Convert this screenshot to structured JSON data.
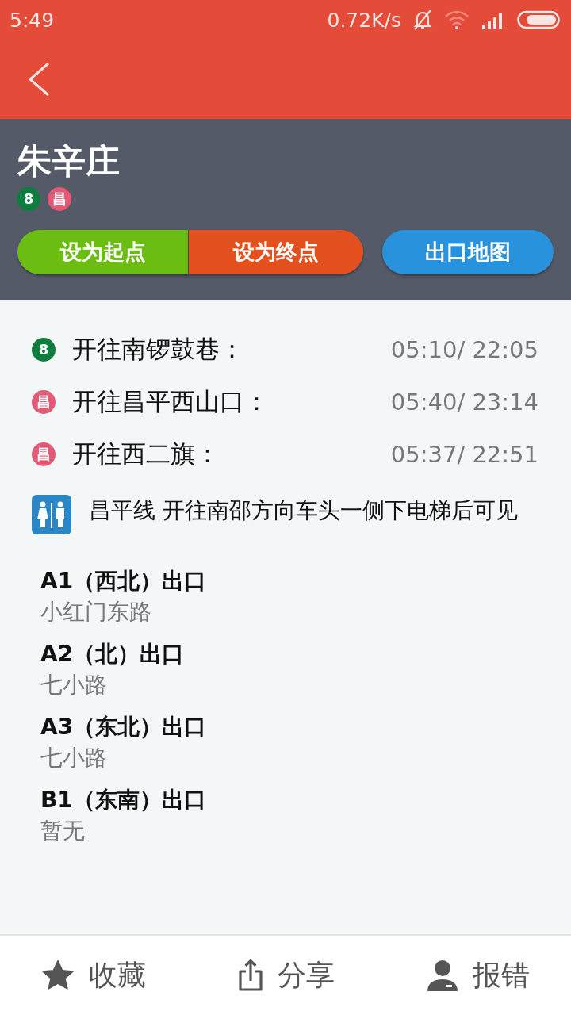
{
  "status_bar": {
    "time": "5:49",
    "speed": "0.72K/s"
  },
  "station": {
    "name": "朱辛庄",
    "lines": [
      {
        "label": "8",
        "color": "#0d7d3e"
      },
      {
        "label": "昌",
        "color": "#e35a77"
      }
    ]
  },
  "actions": [
    {
      "label": "设为起点",
      "color": "#6bbd12"
    },
    {
      "label": "设为终点",
      "color": "#e5501f"
    },
    {
      "label": "出口地图",
      "color": "#2992dc"
    }
  ],
  "departures": [
    {
      "line": "8",
      "color": "#0d7d3e",
      "direction": "开往南锣鼓巷：",
      "times": "05:10/ 22:05"
    },
    {
      "line": "昌",
      "color": "#e35a77",
      "direction": "开往昌平西山口：",
      "times": "05:40/ 23:14"
    },
    {
      "line": "昌",
      "color": "#e35a77",
      "direction": "开往西二旗：",
      "times": "05:37/ 22:51"
    }
  ],
  "restroom_note": "昌平线 开往南邵方向车头一侧下电梯后可见",
  "exits": [
    {
      "name": "A1（西北）出口",
      "road": "小红门东路"
    },
    {
      "name": "A2（北）出口",
      "road": "七小路"
    },
    {
      "name": "A3（东北）出口",
      "road": "七小路"
    },
    {
      "name": "B1（东南）出口",
      "road": "暂无"
    }
  ],
  "bottom_bar": [
    {
      "label": "收藏",
      "kind": "star"
    },
    {
      "label": "分享",
      "kind": "share"
    },
    {
      "label": "报错",
      "kind": "user"
    }
  ]
}
